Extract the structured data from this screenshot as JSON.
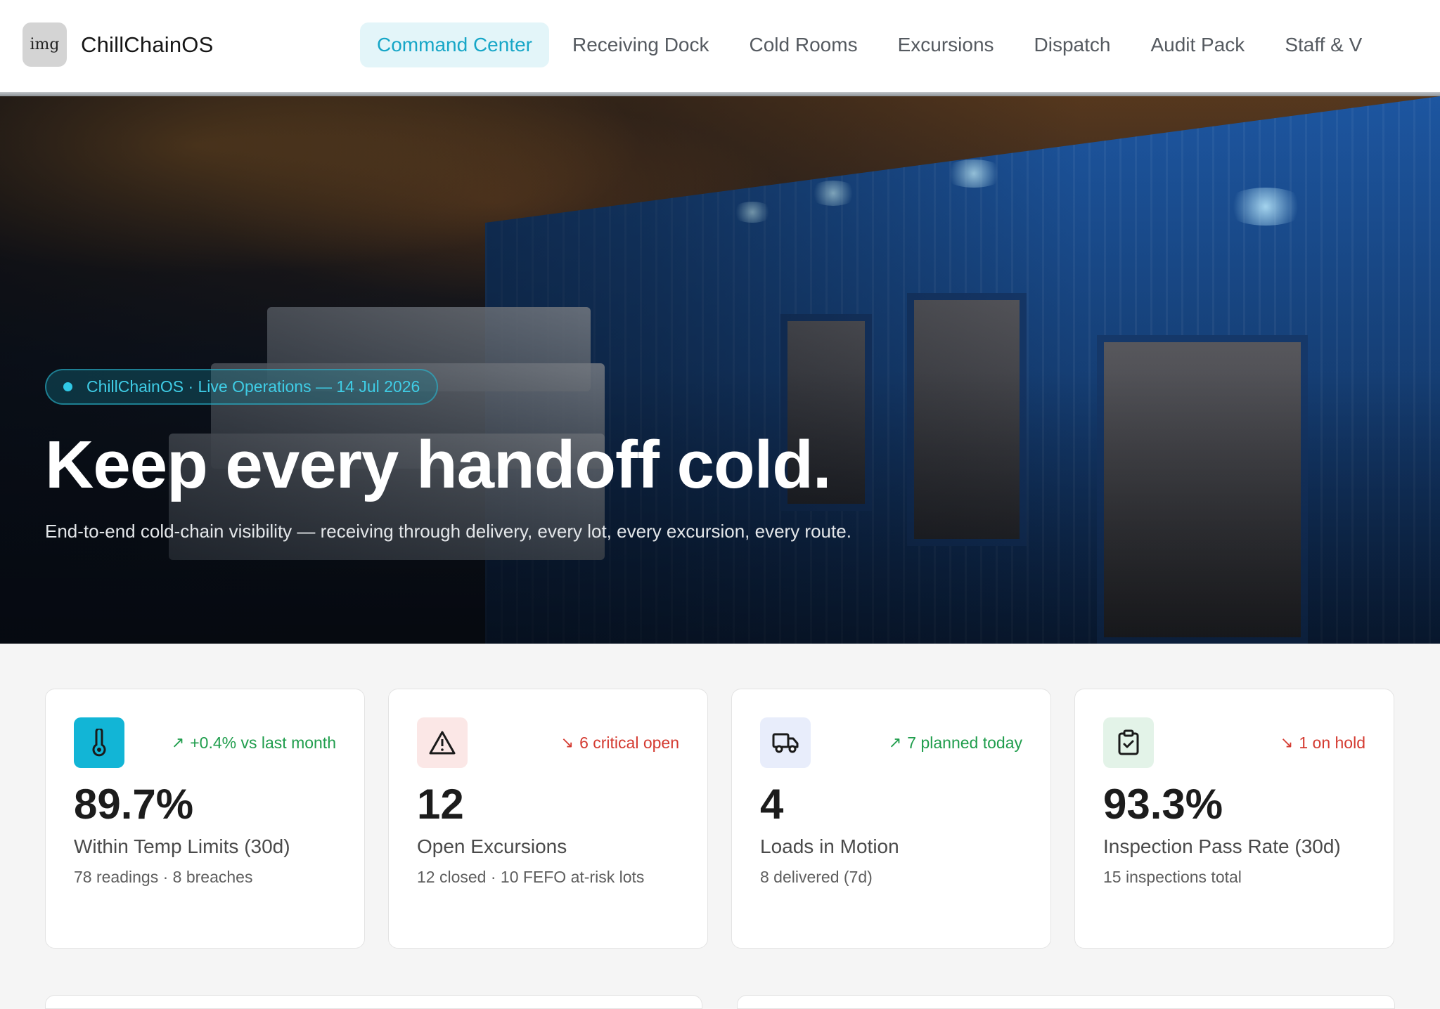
{
  "brand": {
    "logo_text": "img",
    "name": "ChillChainOS"
  },
  "nav": {
    "items": [
      {
        "label": "Command Center",
        "active": true
      },
      {
        "label": "Receiving Dock",
        "active": false
      },
      {
        "label": "Cold Rooms",
        "active": false
      },
      {
        "label": "Excursions",
        "active": false
      },
      {
        "label": "Dispatch",
        "active": false
      },
      {
        "label": "Audit Pack",
        "active": false
      },
      {
        "label": "Staff & V",
        "active": false
      }
    ]
  },
  "hero": {
    "pill": "ChillChainOS · Live Operations — 14 Jul 2026",
    "title": "Keep every handoff cold.",
    "subtitle": "End-to-end cold-chain visibility — receiving through delivery, every lot, every excursion, every route."
  },
  "cards": [
    {
      "icon": "thermometer-icon",
      "icon_bg": "#12b5d6",
      "trend": "+0.4% vs last month",
      "trend_dir": "up",
      "value": "89.7%",
      "label": "Within Temp Limits (30d)",
      "meta": "78 readings · 8 breaches"
    },
    {
      "icon": "warning-icon",
      "icon_bg": "#fbe7e6",
      "trend": "6 critical open",
      "trend_dir": "down",
      "value": "12",
      "label": "Open Excursions",
      "meta": "12 closed · 10 FEFO at-risk lots"
    },
    {
      "icon": "truck-icon",
      "icon_bg": "#e8edfb",
      "trend": "7 planned today",
      "trend_dir": "up",
      "value": "4",
      "label": "Loads in Motion",
      "meta": "8 delivered (7d)"
    },
    {
      "icon": "clipboard-check-icon",
      "icon_bg": "#e3f3e8",
      "trend": "1 on hold",
      "trend_dir": "down",
      "value": "93.3%",
      "label": "Inspection Pass Rate (30d)",
      "meta": "15 inspections total"
    }
  ],
  "colors": {
    "accent": "#16a6c7",
    "up": "#1f9d4c",
    "down": "#d43a30"
  }
}
